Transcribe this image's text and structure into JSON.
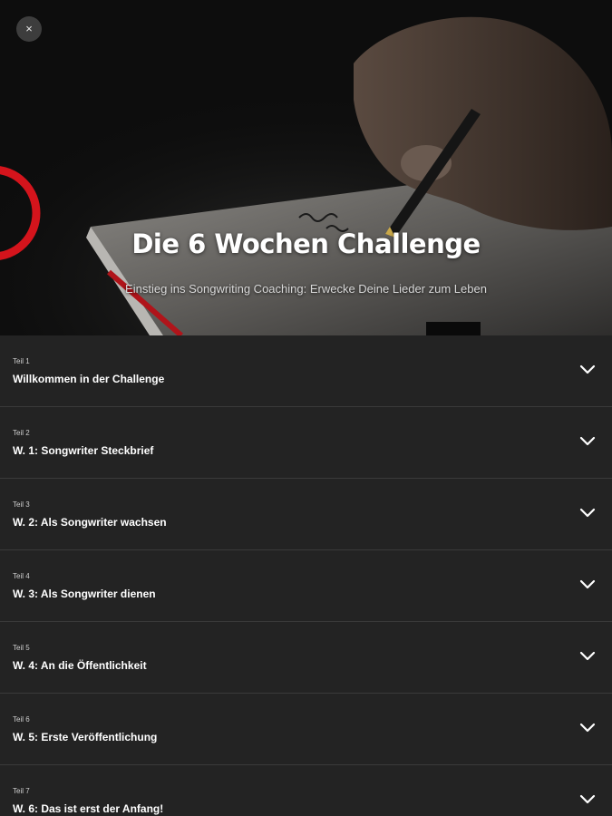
{
  "hero": {
    "close_label": "×",
    "title": "Die 6 Wochen Challenge",
    "subtitle": "Einstieg ins Songwriting Coaching: Erwecke Deine Lieder zum Leben"
  },
  "lessons": [
    {
      "part": "Teil 1",
      "title": "Willkommen in der Challenge"
    },
    {
      "part": "Teil 2",
      "title": "W. 1: Songwriter Steckbrief"
    },
    {
      "part": "Teil 3",
      "title": "W. 2: Als Songwriter wachsen"
    },
    {
      "part": "Teil 4",
      "title": "W. 3: Als Songwriter dienen"
    },
    {
      "part": "Teil 5",
      "title": "W. 4: An die Öffentlichkeit"
    },
    {
      "part": "Teil 6",
      "title": "W. 5: Erste Veröffentlichung"
    },
    {
      "part": "Teil 7",
      "title": "W. 6: Das ist erst der Anfang!"
    }
  ],
  "icons": {
    "close": "close-icon",
    "expand": "chevron-down-icon"
  },
  "colors": {
    "background": "#222222",
    "accent_red": "#d4141c"
  }
}
